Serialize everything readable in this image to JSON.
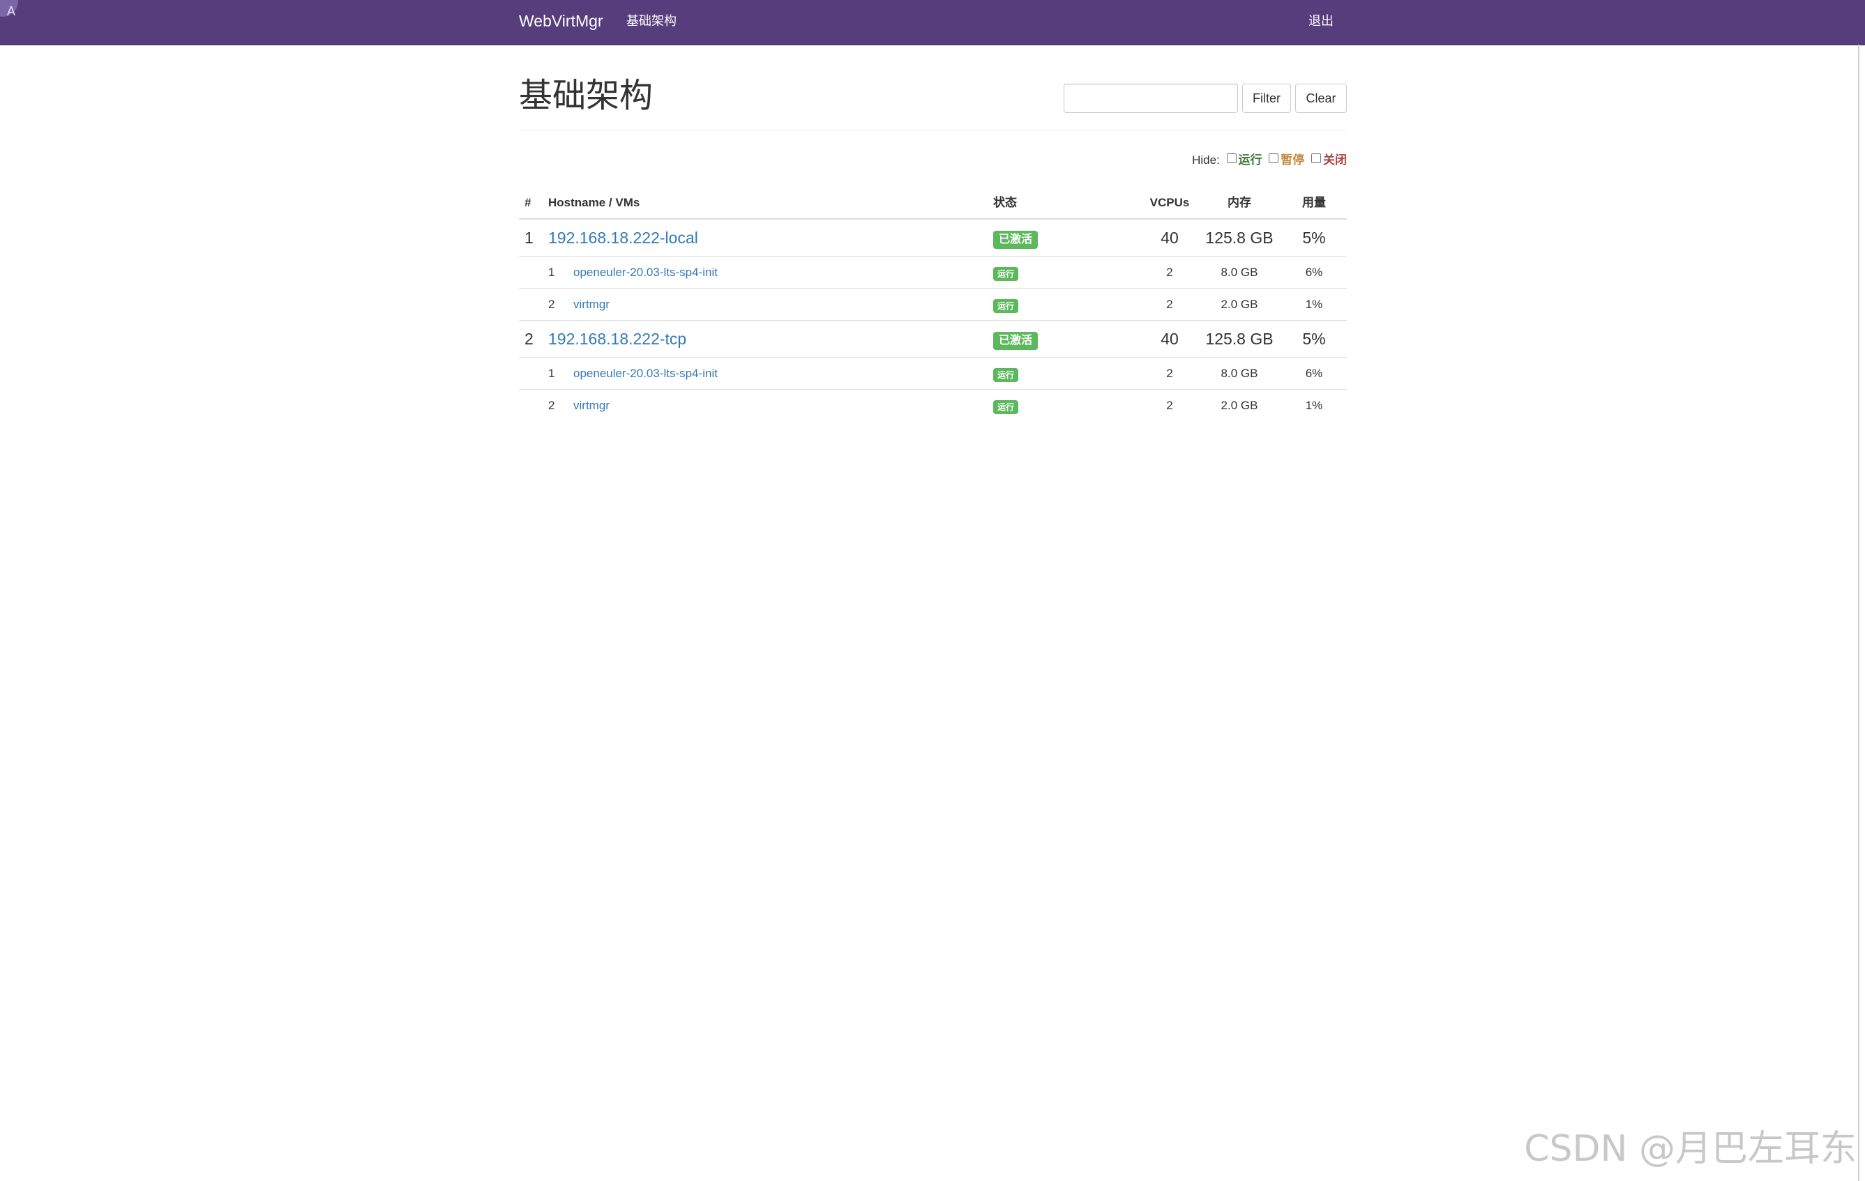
{
  "navbar": {
    "brand": "WebVirtMgr",
    "infrastructure_link": "基础架构",
    "logout_link": "退出",
    "corner_letter": "A",
    "background_color": "#563d7c"
  },
  "page": {
    "title": "基础架构"
  },
  "filter": {
    "input_value": "",
    "filter_button": "Filter",
    "clear_button": "Clear"
  },
  "hide": {
    "label": "Hide:",
    "options": [
      {
        "label": "运行",
        "checked": false,
        "color": "#3c763d"
      },
      {
        "label": "暂停",
        "checked": false,
        "color": "#c58a3d"
      },
      {
        "label": "关闭",
        "checked": false,
        "color": "#a94442"
      }
    ]
  },
  "table": {
    "headers": {
      "index": "#",
      "name": "Hostname / VMs",
      "status": "状态",
      "vcpus": "VCPUs",
      "memory": "内存",
      "usage": "用量"
    },
    "hosts": [
      {
        "index": "1",
        "hostname": "192.168.18.222-local",
        "status": "已激活",
        "vcpus": "40",
        "memory": "125.8 GB",
        "usage": "5%",
        "vms": [
          {
            "index": "1",
            "name": "openeuler-20.03-lts-sp4-init",
            "status": "运行",
            "vcpus": "2",
            "memory": "8.0 GB",
            "usage": "6%"
          },
          {
            "index": "2",
            "name": "virtmgr",
            "status": "运行",
            "vcpus": "2",
            "memory": "2.0 GB",
            "usage": "1%"
          }
        ]
      },
      {
        "index": "2",
        "hostname": "192.168.18.222-tcp",
        "status": "已激活",
        "vcpus": "40",
        "memory": "125.8 GB",
        "usage": "5%",
        "vms": [
          {
            "index": "1",
            "name": "openeuler-20.03-lts-sp4-init",
            "status": "运行",
            "vcpus": "2",
            "memory": "8.0 GB",
            "usage": "6%"
          },
          {
            "index": "2",
            "name": "virtmgr",
            "status": "运行",
            "vcpus": "2",
            "memory": "2.0 GB",
            "usage": "1%"
          }
        ]
      }
    ],
    "status_color": "#5cb85c",
    "link_color": "#337ab7"
  },
  "watermark": "CSDN @月巴左耳东"
}
